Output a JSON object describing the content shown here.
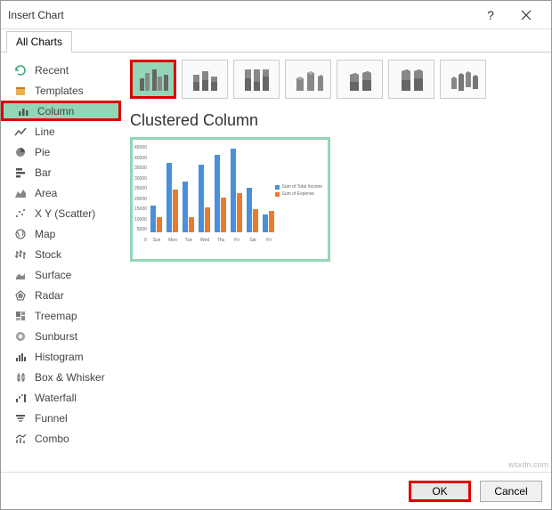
{
  "titlebar": {
    "title": "Insert Chart"
  },
  "tab": {
    "all_charts": "All Charts"
  },
  "sidebar": {
    "items": [
      {
        "label": "Recent"
      },
      {
        "label": "Templates"
      },
      {
        "label": "Column"
      },
      {
        "label": "Line"
      },
      {
        "label": "Pie"
      },
      {
        "label": "Bar"
      },
      {
        "label": "Area"
      },
      {
        "label": "X Y (Scatter)"
      },
      {
        "label": "Map"
      },
      {
        "label": "Stock"
      },
      {
        "label": "Surface"
      },
      {
        "label": "Radar"
      },
      {
        "label": "Treemap"
      },
      {
        "label": "Sunburst"
      },
      {
        "label": "Histogram"
      },
      {
        "label": "Box & Whisker"
      },
      {
        "label": "Waterfall"
      },
      {
        "label": "Funnel"
      },
      {
        "label": "Combo"
      }
    ]
  },
  "main": {
    "chart_title": "Clustered Column",
    "preview": {
      "y_ticks": [
        "45000",
        "40000",
        "35000",
        "30000",
        "25000",
        "20000",
        "15000",
        "10000",
        "5000",
        "0"
      ],
      "legend": [
        "Sum of Total Income",
        "Sum of Expense"
      ]
    }
  },
  "buttons": {
    "ok": "OK",
    "cancel": "Cancel"
  },
  "watermark": "wsxdn.com",
  "chart_data": {
    "type": "bar",
    "categories": [
      "Sun",
      "Mon",
      "Tue",
      "Wed",
      "Thu",
      "Fri",
      "Sat",
      "Fri"
    ],
    "series": [
      {
        "name": "Sum of Total Income",
        "color": "#4a90d9",
        "values": [
          14000,
          36000,
          26000,
          35000,
          40000,
          43000,
          23000,
          9000
        ]
      },
      {
        "name": "Sum of Expense",
        "color": "#e87b2f",
        "values": [
          8000,
          22000,
          8000,
          13000,
          18000,
          20000,
          12000,
          11000
        ]
      }
    ],
    "ylim": [
      0,
      45000
    ],
    "ylabel": "",
    "xlabel": "",
    "title": ""
  }
}
